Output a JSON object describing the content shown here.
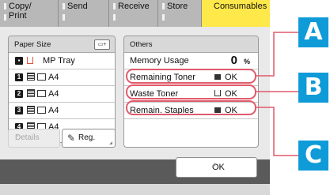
{
  "tabs": [
    {
      "line1": "Copy/",
      "line2": "Print",
      "active": false
    },
    {
      "line1": "Send",
      "line2": "",
      "active": false
    },
    {
      "line1": "Receive",
      "line2": "",
      "active": false
    },
    {
      "line1": "Store",
      "line2": "",
      "active": false
    },
    {
      "line1": "Consumables",
      "line2": "",
      "active": true
    }
  ],
  "paper": {
    "header": "Paper Size",
    "rows": [
      {
        "number": "",
        "label": "MP Tray",
        "icon": "mp-tray-icon"
      },
      {
        "number": "1",
        "label": "A4",
        "icon": "paper-level-icon"
      },
      {
        "number": "2",
        "label": "A4",
        "icon": "paper-level-icon"
      },
      {
        "number": "3",
        "label": "A4",
        "icon": "paper-level-icon"
      },
      {
        "number": "4",
        "label": "A4",
        "icon": "paper-level-icon"
      }
    ]
  },
  "buttons": {
    "details": "Details",
    "reg": "Reg.",
    "ok": "OK"
  },
  "others": {
    "header": "Others",
    "memory_label": "Memory Usage",
    "memory_value": "0",
    "memory_unit": "%",
    "items": [
      {
        "name": "Remaining Toner",
        "status": "OK",
        "icon": "toner-icon"
      },
      {
        "name": "Waste Toner",
        "status": "OK",
        "icon": "waste-toner-icon"
      },
      {
        "name": "Remain. Staples",
        "status": "OK",
        "icon": "staples-icon"
      }
    ]
  },
  "callouts": [
    "A",
    "B",
    "C"
  ],
  "colors": {
    "active_tab": "#ffe84a",
    "highlight": "#e05a6a",
    "callout": "#0e9bd8",
    "screen_frame": "#5a5a5a"
  }
}
